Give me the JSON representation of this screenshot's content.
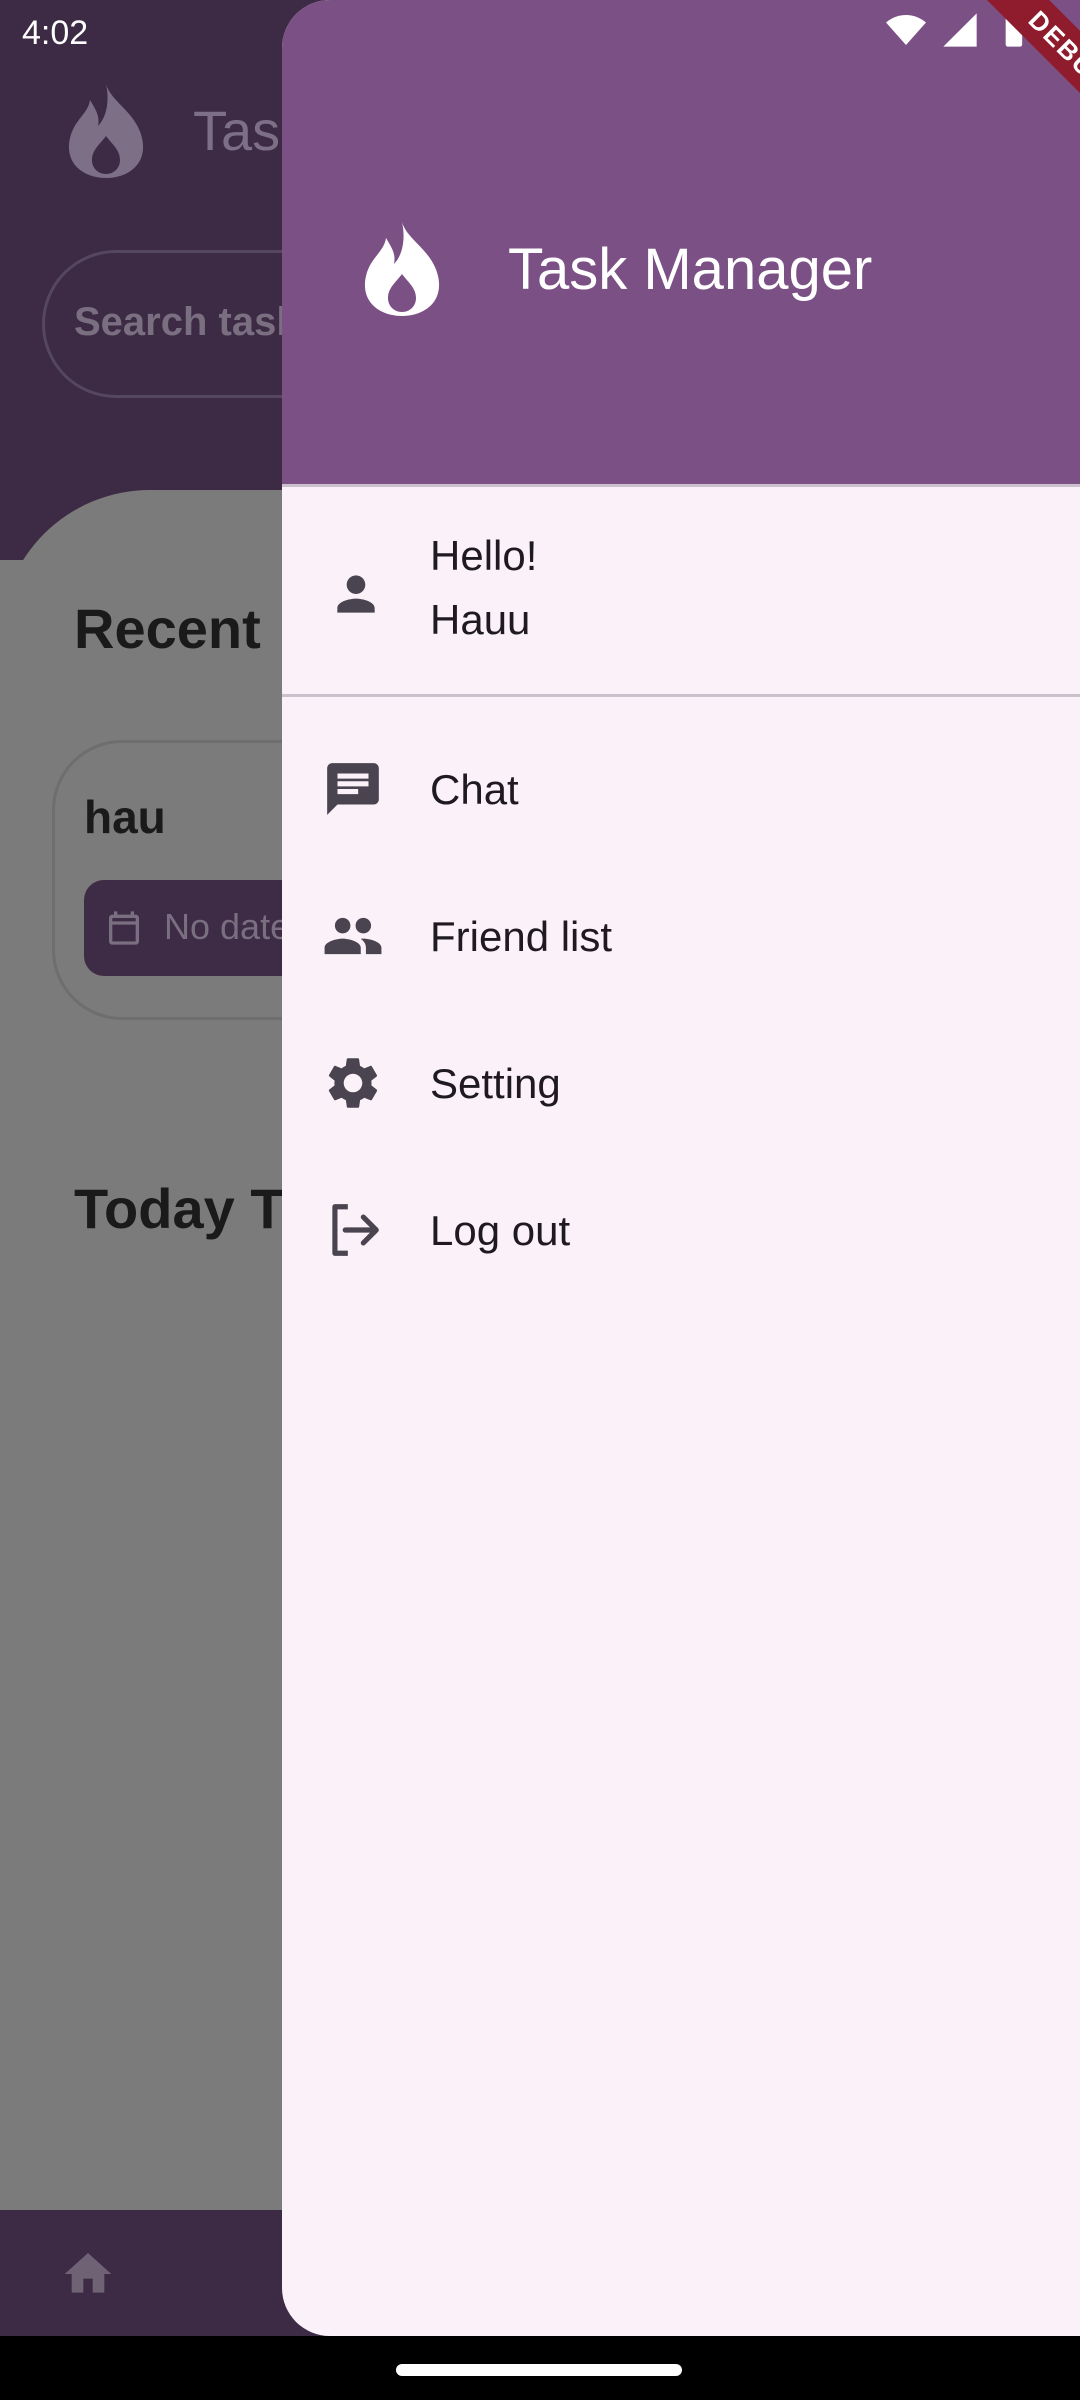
{
  "status_bar": {
    "time": "4:02",
    "icons": [
      "wifi-icon",
      "cell-signal-icon",
      "battery-icon"
    ]
  },
  "background_screen": {
    "app_title": "Task",
    "search_placeholder": "Search task",
    "recent_heading": "Recent",
    "recent_card": {
      "title": "hau",
      "date_chip": "No date"
    },
    "today_heading": "Today Ta"
  },
  "drawer": {
    "header": {
      "title": "Task Manager",
      "logo_icon": "flame-icon",
      "background": "#7b5185"
    },
    "profile": {
      "greeting": "Hello!",
      "name": "Hauu",
      "icon": "person-icon"
    },
    "items": [
      {
        "label": "Chat",
        "icon": "chat-icon"
      },
      {
        "label": "Friend list",
        "icon": "people-icon"
      },
      {
        "label": "Setting",
        "icon": "gear-icon"
      },
      {
        "label": "Log out",
        "icon": "logout-icon"
      }
    ]
  },
  "debug_banner": "DEBUG",
  "colors": {
    "primary": "#7b5185",
    "drawer_bg": "#fbf1f9",
    "scrim_dark": "#3d2a44",
    "debug": "#8e1c2c"
  }
}
